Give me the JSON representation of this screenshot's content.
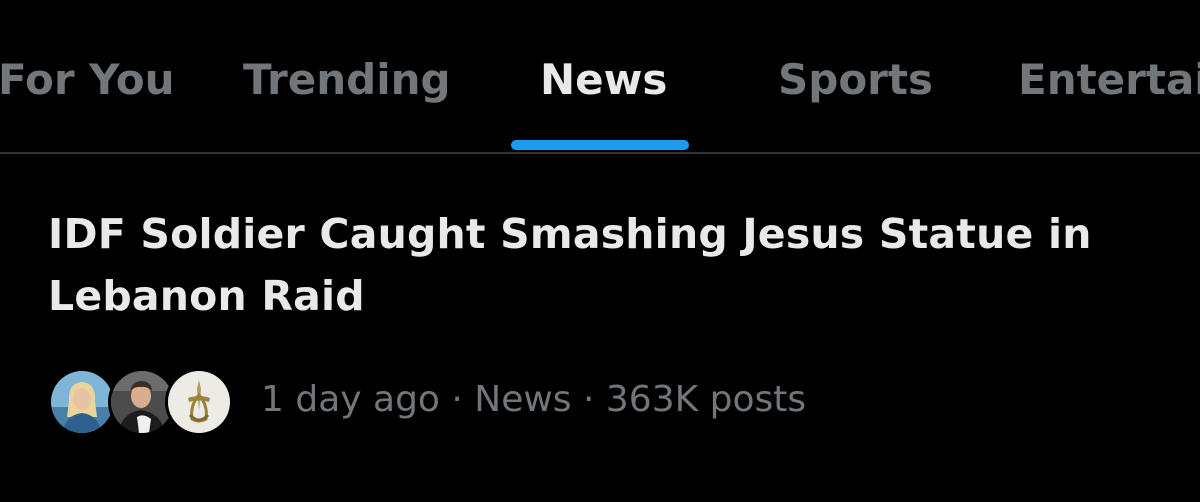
{
  "tabs": [
    {
      "label": "For You",
      "active": false
    },
    {
      "label": "Trending",
      "active": false
    },
    {
      "label": "News",
      "active": true
    },
    {
      "label": "Sports",
      "active": false
    },
    {
      "label": "Entertai",
      "active": false
    }
  ],
  "colors": {
    "accent": "#1d9bf0",
    "background": "#000000",
    "text_primary": "#e7e9ea",
    "text_secondary": "#71767b",
    "divider": "#2f3336"
  },
  "trend": {
    "headline": "IDF Soldier Caught Smashing Jesus Statue in Lebanon Raid",
    "meta": "1 day ago · News · 363K posts",
    "avatars": [
      {
        "icon": "woman-portrait-avatar"
      },
      {
        "icon": "man-portrait-avatar"
      },
      {
        "icon": "idf-emblem-avatar"
      }
    ]
  }
}
